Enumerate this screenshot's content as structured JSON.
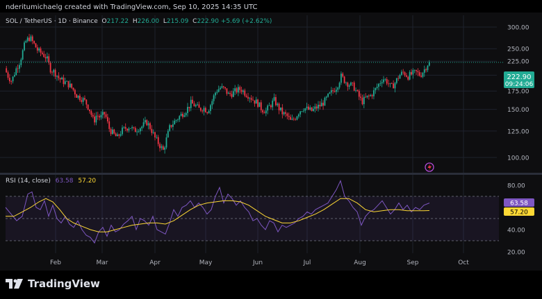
{
  "header": {
    "attribution": "nderitumichaelg created with TradingView.com, Sep 10, 2025 14:35 UTC"
  },
  "symbol": {
    "name": "SOL / TetherUS · 1D · Binance",
    "o_label": "O",
    "o": "217.22",
    "h_label": "H",
    "h": "226.00",
    "l_label": "L",
    "l": "215.09",
    "c_label": "C",
    "c": "222.90",
    "change": "+5.69 (+2.62%)"
  },
  "price_badge": {
    "price": "222.90",
    "countdown": "09:24:06"
  },
  "rsi_legend": {
    "label": "RSI (14, close)",
    "rsi": "63.58",
    "ma": "57.20"
  },
  "rsi_badges": {
    "rsi": "63.58",
    "ma": "57.20"
  },
  "footer": {
    "brand": "TradingView"
  },
  "colors": {
    "up": "#22ab94",
    "down": "#f23645",
    "rsi": "#7e57c2",
    "rsi_ma": "#fdd835",
    "badge_price": "#22ab94"
  },
  "chart_data": [
    {
      "type": "candlestick",
      "x": [
        "Feb",
        "Mar",
        "Apr",
        "May",
        "Jun",
        "Jul",
        "Aug",
        "Sep",
        "Oct"
      ],
      "y_ticks": [
        "300.00",
        "250.00",
        "225.00",
        "200.00",
        "175.00",
        "150.00",
        "125.00",
        "100.00"
      ],
      "y_tick_values": [
        300,
        250,
        225,
        200,
        175,
        150,
        125,
        100
      ],
      "scale": "log",
      "last_price": 222.9,
      "path": [
        [
          0,
          215
        ],
        [
          6,
          218
        ],
        [
          12,
          200
        ],
        [
          18,
          190
        ],
        [
          24,
          210
        ],
        [
          30,
          225
        ],
        [
          38,
          265
        ],
        [
          44,
          275
        ],
        [
          50,
          260
        ],
        [
          56,
          245
        ],
        [
          62,
          240
        ],
        [
          68,
          232
        ],
        [
          74,
          210
        ],
        [
          80,
          205
        ],
        [
          86,
          195
        ],
        [
          92,
          190
        ],
        [
          100,
          185
        ],
        [
          106,
          178
        ],
        [
          112,
          168
        ],
        [
          118,
          165
        ],
        [
          124,
          160
        ],
        [
          130,
          150
        ],
        [
          136,
          135
        ],
        [
          140,
          143
        ],
        [
          146,
          140
        ],
        [
          152,
          145
        ],
        [
          158,
          128
        ],
        [
          164,
          122
        ],
        [
          170,
          118
        ],
        [
          176,
          125
        ],
        [
          182,
          128
        ],
        [
          188,
          130
        ],
        [
          194,
          125
        ],
        [
          200,
          128
        ],
        [
          206,
          130
        ],
        [
          212,
          135
        ],
        [
          218,
          128
        ],
        [
          224,
          118
        ],
        [
          230,
          112
        ],
        [
          236,
          106
        ],
        [
          240,
          115
        ],
        [
          246,
          130
        ],
        [
          252,
          135
        ],
        [
          258,
          140
        ],
        [
          264,
          145
        ],
        [
          270,
          150
        ],
        [
          276,
          158
        ],
        [
          282,
          155
        ],
        [
          288,
          150
        ],
        [
          294,
          152
        ],
        [
          300,
          148
        ],
        [
          306,
          160
        ],
        [
          312,
          175
        ],
        [
          318,
          180
        ],
        [
          324,
          178
        ],
        [
          330,
          170
        ],
        [
          336,
          172
        ],
        [
          342,
          176
        ],
        [
          348,
          178
        ],
        [
          354,
          172
        ],
        [
          360,
          168
        ],
        [
          366,
          162
        ],
        [
          372,
          158
        ],
        [
          378,
          150
        ],
        [
          384,
          148
        ],
        [
          390,
          155
        ],
        [
          396,
          162
        ],
        [
          402,
          152
        ],
        [
          408,
          145
        ],
        [
          414,
          142
        ],
        [
          420,
          135
        ],
        [
          426,
          140
        ],
        [
          432,
          148
        ],
        [
          438,
          152
        ],
        [
          444,
          150
        ],
        [
          450,
          148
        ],
        [
          456,
          152
        ],
        [
          462,
          155
        ],
        [
          468,
          160
        ],
        [
          474,
          168
        ],
        [
          480,
          175
        ],
        [
          486,
          182
        ],
        [
          492,
          198
        ],
        [
          498,
          190
        ],
        [
          504,
          185
        ],
        [
          510,
          182
        ],
        [
          516,
          170
        ],
        [
          522,
          160
        ],
        [
          528,
          165
        ],
        [
          534,
          168
        ],
        [
          540,
          175
        ],
        [
          546,
          185
        ],
        [
          552,
          195
        ],
        [
          558,
          190
        ],
        [
          564,
          180
        ],
        [
          570,
          188
        ],
        [
          576,
          200
        ],
        [
          582,
          205
        ],
        [
          588,
          198
        ],
        [
          594,
          202
        ],
        [
          600,
          205
        ],
        [
          606,
          200
        ],
        [
          612,
          210
        ],
        [
          618,
          222.9
        ]
      ]
    },
    {
      "type": "line",
      "title": "RSI (14, close)",
      "y_ticks": [
        "80.00",
        "40.00",
        "20.00"
      ],
      "y_tick_values": [
        80,
        40,
        20
      ],
      "bands": [
        70,
        50,
        30
      ],
      "series": [
        {
          "name": "RSI",
          "values": [
            [
              8,
              60
            ],
            [
              16,
              54
            ],
            [
              24,
              48
            ],
            [
              32,
              52
            ],
            [
              40,
              72
            ],
            [
              46,
              74
            ],
            [
              52,
              60
            ],
            [
              58,
              58
            ],
            [
              64,
              66
            ],
            [
              70,
              52
            ],
            [
              76,
              62
            ],
            [
              82,
              50
            ],
            [
              88,
              46
            ],
            [
              94,
              52
            ],
            [
              100,
              45
            ],
            [
              106,
              42
            ],
            [
              112,
              48
            ],
            [
              118,
              40
            ],
            [
              124,
              35
            ],
            [
              130,
              33
            ],
            [
              136,
              28
            ],
            [
              142,
              38
            ],
            [
              148,
              42
            ],
            [
              154,
              34
            ],
            [
              160,
              44
            ],
            [
              166,
              38
            ],
            [
              172,
              40
            ],
            [
              178,
              45
            ],
            [
              184,
              48
            ],
            [
              190,
              52
            ],
            [
              196,
              40
            ],
            [
              202,
              50
            ],
            [
              208,
              48
            ],
            [
              214,
              44
            ],
            [
              220,
              52
            ],
            [
              226,
              40
            ],
            [
              232,
              38
            ],
            [
              238,
              36
            ],
            [
              244,
              46
            ],
            [
              250,
              58
            ],
            [
              256,
              52
            ],
            [
              262,
              60
            ],
            [
              268,
              62
            ],
            [
              274,
              66
            ],
            [
              280,
              60
            ],
            [
              286,
              64
            ],
            [
              292,
              60
            ],
            [
              298,
              54
            ],
            [
              304,
              58
            ],
            [
              310,
              70
            ],
            [
              316,
              78
            ],
            [
              322,
              64
            ],
            [
              328,
              72
            ],
            [
              334,
              68
            ],
            [
              340,
              62
            ],
            [
              346,
              66
            ],
            [
              352,
              60
            ],
            [
              358,
              56
            ],
            [
              364,
              48
            ],
            [
              370,
              50
            ],
            [
              376,
              44
            ],
            [
              382,
              40
            ],
            [
              388,
              48
            ],
            [
              394,
              46
            ],
            [
              400,
              38
            ],
            [
              406,
              44
            ],
            [
              412,
              42
            ],
            [
              418,
              44
            ],
            [
              424,
              46
            ],
            [
              430,
              50
            ],
            [
              436,
              52
            ],
            [
              442,
              56
            ],
            [
              448,
              54
            ],
            [
              454,
              58
            ],
            [
              460,
              60
            ],
            [
              466,
              62
            ],
            [
              472,
              64
            ],
            [
              478,
              70
            ],
            [
              484,
              76
            ],
            [
              490,
              84
            ],
            [
              496,
              70
            ],
            [
              502,
              66
            ],
            [
              508,
              60
            ],
            [
              514,
              56
            ],
            [
              520,
              44
            ],
            [
              526,
              52
            ],
            [
              532,
              56
            ],
            [
              538,
              58
            ],
            [
              544,
              62
            ],
            [
              550,
              66
            ],
            [
              556,
              60
            ],
            [
              562,
              54
            ],
            [
              568,
              58
            ],
            [
              574,
              64
            ],
            [
              580,
              58
            ],
            [
              586,
              62
            ],
            [
              592,
              56
            ],
            [
              598,
              60
            ],
            [
              604,
              58
            ],
            [
              610,
              62
            ],
            [
              618,
              64
            ]
          ]
        },
        {
          "name": "MA",
          "values": [
            [
              8,
              52
            ],
            [
              20,
              52
            ],
            [
              32,
              56
            ],
            [
              44,
              60
            ],
            [
              56,
              65
            ],
            [
              66,
              68
            ],
            [
              76,
              65
            ],
            [
              86,
              58
            ],
            [
              96,
              50
            ],
            [
              106,
              46
            ],
            [
              118,
              43
            ],
            [
              130,
              40
            ],
            [
              142,
              38
            ],
            [
              154,
              38
            ],
            [
              166,
              40
            ],
            [
              178,
              42
            ],
            [
              190,
              44
            ],
            [
              202,
              45
            ],
            [
              214,
              46
            ],
            [
              226,
              46
            ],
            [
              238,
              45
            ],
            [
              250,
              48
            ],
            [
              262,
              53
            ],
            [
              274,
              58
            ],
            [
              286,
              62
            ],
            [
              298,
              64
            ],
            [
              310,
              65
            ],
            [
              322,
              66
            ],
            [
              334,
              66
            ],
            [
              346,
              65
            ],
            [
              358,
              62
            ],
            [
              370,
              57
            ],
            [
              382,
              52
            ],
            [
              394,
              49
            ],
            [
              406,
              46
            ],
            [
              418,
              46
            ],
            [
              430,
              48
            ],
            [
              442,
              51
            ],
            [
              454,
              54
            ],
            [
              466,
              58
            ],
            [
              478,
              63
            ],
            [
              490,
              68
            ],
            [
              502,
              68
            ],
            [
              514,
              64
            ],
            [
              526,
              58
            ],
            [
              538,
              56
            ],
            [
              550,
              57
            ],
            [
              562,
              58
            ],
            [
              574,
              58
            ],
            [
              586,
              57
            ],
            [
              598,
              57
            ],
            [
              610,
              57
            ],
            [
              618,
              57.2
            ]
          ]
        }
      ]
    }
  ]
}
